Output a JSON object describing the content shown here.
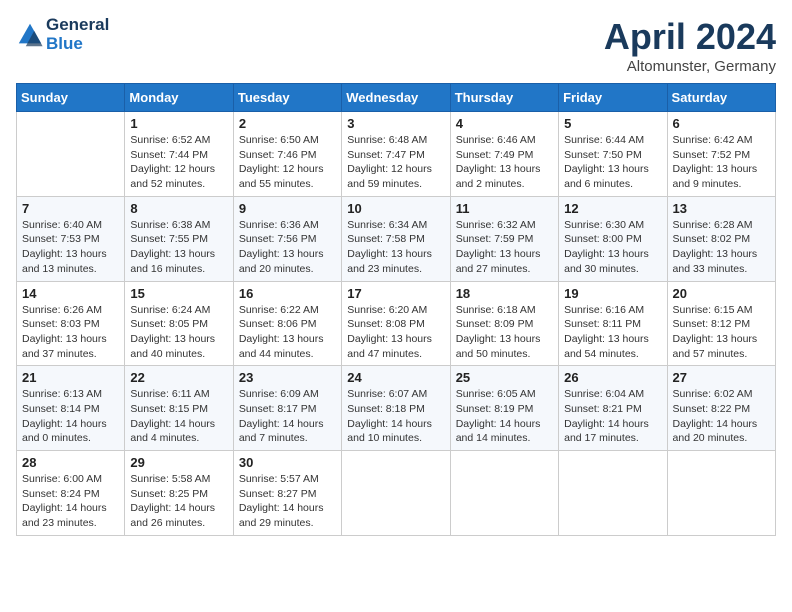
{
  "header": {
    "logo_line1": "General",
    "logo_line2": "Blue",
    "month_title": "April 2024",
    "subtitle": "Altomunster, Germany"
  },
  "days_of_week": [
    "Sunday",
    "Monday",
    "Tuesday",
    "Wednesday",
    "Thursday",
    "Friday",
    "Saturday"
  ],
  "weeks": [
    [
      {
        "day": "",
        "info": ""
      },
      {
        "day": "1",
        "info": "Sunrise: 6:52 AM\nSunset: 7:44 PM\nDaylight: 12 hours\nand 52 minutes."
      },
      {
        "day": "2",
        "info": "Sunrise: 6:50 AM\nSunset: 7:46 PM\nDaylight: 12 hours\nand 55 minutes."
      },
      {
        "day": "3",
        "info": "Sunrise: 6:48 AM\nSunset: 7:47 PM\nDaylight: 12 hours\nand 59 minutes."
      },
      {
        "day": "4",
        "info": "Sunrise: 6:46 AM\nSunset: 7:49 PM\nDaylight: 13 hours\nand 2 minutes."
      },
      {
        "day": "5",
        "info": "Sunrise: 6:44 AM\nSunset: 7:50 PM\nDaylight: 13 hours\nand 6 minutes."
      },
      {
        "day": "6",
        "info": "Sunrise: 6:42 AM\nSunset: 7:52 PM\nDaylight: 13 hours\nand 9 minutes."
      }
    ],
    [
      {
        "day": "7",
        "info": "Sunrise: 6:40 AM\nSunset: 7:53 PM\nDaylight: 13 hours\nand 13 minutes."
      },
      {
        "day": "8",
        "info": "Sunrise: 6:38 AM\nSunset: 7:55 PM\nDaylight: 13 hours\nand 16 minutes."
      },
      {
        "day": "9",
        "info": "Sunrise: 6:36 AM\nSunset: 7:56 PM\nDaylight: 13 hours\nand 20 minutes."
      },
      {
        "day": "10",
        "info": "Sunrise: 6:34 AM\nSunset: 7:58 PM\nDaylight: 13 hours\nand 23 minutes."
      },
      {
        "day": "11",
        "info": "Sunrise: 6:32 AM\nSunset: 7:59 PM\nDaylight: 13 hours\nand 27 minutes."
      },
      {
        "day": "12",
        "info": "Sunrise: 6:30 AM\nSunset: 8:00 PM\nDaylight: 13 hours\nand 30 minutes."
      },
      {
        "day": "13",
        "info": "Sunrise: 6:28 AM\nSunset: 8:02 PM\nDaylight: 13 hours\nand 33 minutes."
      }
    ],
    [
      {
        "day": "14",
        "info": "Sunrise: 6:26 AM\nSunset: 8:03 PM\nDaylight: 13 hours\nand 37 minutes."
      },
      {
        "day": "15",
        "info": "Sunrise: 6:24 AM\nSunset: 8:05 PM\nDaylight: 13 hours\nand 40 minutes."
      },
      {
        "day": "16",
        "info": "Sunrise: 6:22 AM\nSunset: 8:06 PM\nDaylight: 13 hours\nand 44 minutes."
      },
      {
        "day": "17",
        "info": "Sunrise: 6:20 AM\nSunset: 8:08 PM\nDaylight: 13 hours\nand 47 minutes."
      },
      {
        "day": "18",
        "info": "Sunrise: 6:18 AM\nSunset: 8:09 PM\nDaylight: 13 hours\nand 50 minutes."
      },
      {
        "day": "19",
        "info": "Sunrise: 6:16 AM\nSunset: 8:11 PM\nDaylight: 13 hours\nand 54 minutes."
      },
      {
        "day": "20",
        "info": "Sunrise: 6:15 AM\nSunset: 8:12 PM\nDaylight: 13 hours\nand 57 minutes."
      }
    ],
    [
      {
        "day": "21",
        "info": "Sunrise: 6:13 AM\nSunset: 8:14 PM\nDaylight: 14 hours\nand 0 minutes."
      },
      {
        "day": "22",
        "info": "Sunrise: 6:11 AM\nSunset: 8:15 PM\nDaylight: 14 hours\nand 4 minutes."
      },
      {
        "day": "23",
        "info": "Sunrise: 6:09 AM\nSunset: 8:17 PM\nDaylight: 14 hours\nand 7 minutes."
      },
      {
        "day": "24",
        "info": "Sunrise: 6:07 AM\nSunset: 8:18 PM\nDaylight: 14 hours\nand 10 minutes."
      },
      {
        "day": "25",
        "info": "Sunrise: 6:05 AM\nSunset: 8:19 PM\nDaylight: 14 hours\nand 14 minutes."
      },
      {
        "day": "26",
        "info": "Sunrise: 6:04 AM\nSunset: 8:21 PM\nDaylight: 14 hours\nand 17 minutes."
      },
      {
        "day": "27",
        "info": "Sunrise: 6:02 AM\nSunset: 8:22 PM\nDaylight: 14 hours\nand 20 minutes."
      }
    ],
    [
      {
        "day": "28",
        "info": "Sunrise: 6:00 AM\nSunset: 8:24 PM\nDaylight: 14 hours\nand 23 minutes."
      },
      {
        "day": "29",
        "info": "Sunrise: 5:58 AM\nSunset: 8:25 PM\nDaylight: 14 hours\nand 26 minutes."
      },
      {
        "day": "30",
        "info": "Sunrise: 5:57 AM\nSunset: 8:27 PM\nDaylight: 14 hours\nand 29 minutes."
      },
      {
        "day": "",
        "info": ""
      },
      {
        "day": "",
        "info": ""
      },
      {
        "day": "",
        "info": ""
      },
      {
        "day": "",
        "info": ""
      }
    ]
  ]
}
